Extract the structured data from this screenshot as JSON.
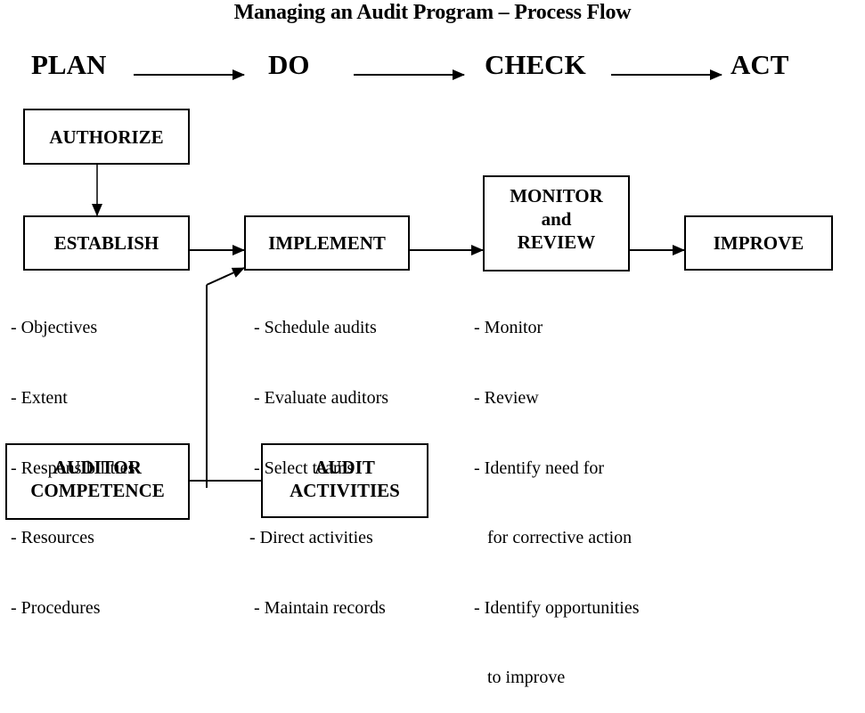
{
  "title": "Managing an Audit Program – Process Flow",
  "pdca": {
    "plan": "PLAN",
    "do": "DO",
    "check": "CHECK",
    "act": "ACT"
  },
  "boxes": {
    "authorize": [
      "AUTHORIZE"
    ],
    "establish": [
      "ESTABLISH"
    ],
    "implement": [
      "IMPLEMENT"
    ],
    "monitor_review": [
      "MONITOR",
      "and",
      "REVIEW"
    ],
    "improve": [
      "IMPROVE"
    ],
    "auditor_competence": [
      "AUDITOR",
      "COMPETENCE"
    ],
    "audit_activities": [
      "AUDIT",
      "ACTIVITIES"
    ]
  },
  "lists": {
    "establish": [
      "- Objectives",
      "- Extent",
      "- Responsibilities",
      "- Resources",
      "- Procedures"
    ],
    "implement": [
      " - Schedule audits",
      " - Evaluate auditors",
      " - Select teams",
      "- Direct activities",
      " - Maintain records"
    ],
    "monitor_review": [
      "- Monitor",
      "- Review",
      "- Identify need for",
      "   for corrective action",
      "- Identify opportunities",
      "   to improve"
    ]
  },
  "connections": [
    {
      "from": "PLAN",
      "to": "DO"
    },
    {
      "from": "DO",
      "to": "CHECK"
    },
    {
      "from": "CHECK",
      "to": "ACT"
    },
    {
      "from": "AUTHORIZE",
      "to": "ESTABLISH"
    },
    {
      "from": "ESTABLISH",
      "to": "IMPLEMENT"
    },
    {
      "from": "IMPLEMENT",
      "to": "MONITOR and REVIEW"
    },
    {
      "from": "MONITOR and REVIEW",
      "to": "IMPROVE"
    },
    {
      "from": "AUDITOR COMPETENCE + AUDIT ACTIVITIES",
      "to": "IMPLEMENT"
    }
  ]
}
